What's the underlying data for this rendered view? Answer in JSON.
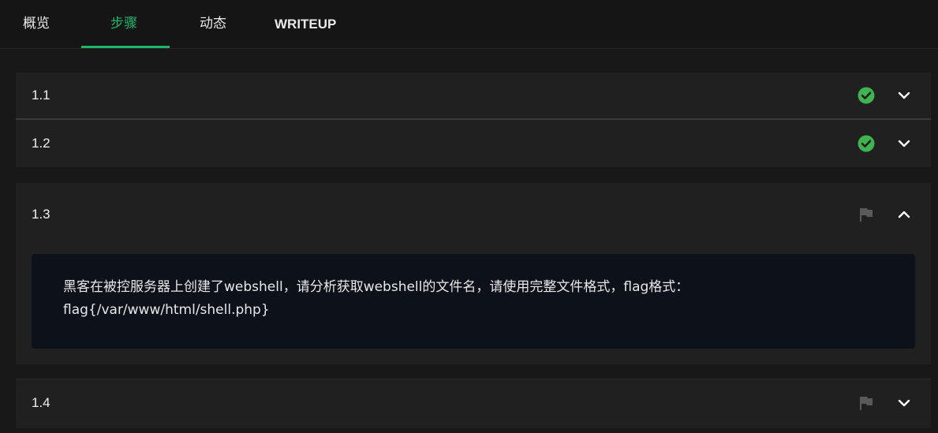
{
  "tabs": [
    {
      "label": "概览"
    },
    {
      "label": "步骤"
    },
    {
      "label": "动态"
    },
    {
      "label": "WRITEUP"
    }
  ],
  "active_tab": "步骤",
  "colors": {
    "accent": "#22b36b",
    "check": "#3fb34f",
    "flag_inactive": "#5a5a5a"
  },
  "steps": [
    {
      "title": "1.1",
      "status_icon": "check-circle-icon",
      "expanded": false
    },
    {
      "title": "1.2",
      "status_icon": "check-circle-icon",
      "expanded": false
    },
    {
      "title": "1.3",
      "status_icon": "flag-icon",
      "expanded": true,
      "question": "黑客在被控服务器上创建了webshell，请分析获取webshell的文件名，请使用完整文件格式，flag格式：flag{/var/www/html/shell.php}"
    },
    {
      "title": "1.4",
      "status_icon": "flag-icon",
      "expanded": false
    }
  ]
}
